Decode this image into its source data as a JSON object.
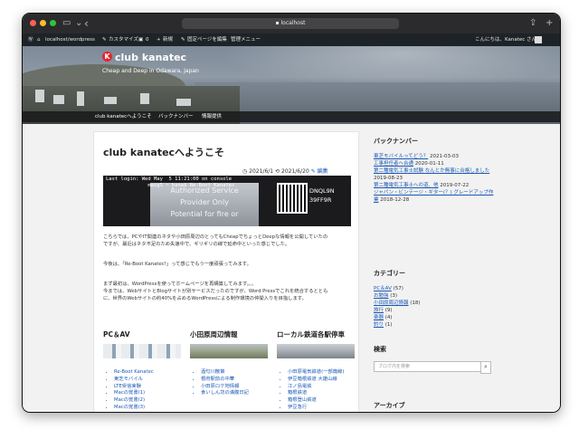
{
  "browser": {
    "address": "localhost",
    "lights": [
      "#ff5f57",
      "#febc2e",
      "#28c840"
    ]
  },
  "admin_bar": {
    "site": "localhost/wordpress",
    "customize": "カスタマイズ",
    "comments": "0",
    "new": "新規",
    "edit_page": "固定ページを編集",
    "menu_label": "管理メニュー",
    "greeting": "こんにちは、Kanatec さん"
  },
  "header": {
    "brand": "club kanatec",
    "logo_letter": "K",
    "tagline": "Cheap and Deep in Odawara, Japan"
  },
  "nav": [
    "club kanatecへようこそ",
    "バックナンバー",
    "情報提供"
  ],
  "post": {
    "title": "club kanatecへようこそ",
    "date": "2021/6/1",
    "modified": "2021/6/20",
    "edit": "編集",
    "hero_terminal": "Last login: Wed May  5 11:21:00 on console\n              macg5 ~ kana$ Re-Boot Kanatec",
    "hero_label_1": "Authorized Service",
    "hero_label_2": "Provider Only",
    "hero_label_3": "Potential for fire or",
    "hero_code_1": "DNQL9N",
    "hero_code_2": "39FF9R",
    "para1_line1": "こちらでは、PCやIT関連のネタや小田原周辺のとってもCheapでちょっとDeepな情報を公開していたの",
    "para1_line2": "ですが、最近はネタ不足のため失速中で、ギリギリの線で延命中といった感じでした。",
    "para2": "今後は、「Re-Boot Kanatec!」って感じでもう一度頑張ってみます。",
    "para3_line1": "まず最初は、WordPressを使ってホームページを再構築してみます。。。",
    "para3_line2": "今までは、WebサイトとBlogサイトが別サービスだったのですが、Word Pressでこれを統合するととも",
    "para3_line3": "に、世界のWebサイトの約40%を占めるWordPressによる制作環境の仲間入りを目指します。"
  },
  "columns": [
    {
      "title": "PC＆AV",
      "links": [
        "Re-Boot Kanatec",
        "東芝モバイル",
        "LTE受信実験",
        "Macの覚書(1)",
        "Macの覚書(2)",
        "Macの覚書(3)"
      ]
    },
    {
      "title": "小田原周辺情報",
      "links": [
        "酒匂川散策",
        "根府駅前の中華",
        "小田原ロケ地情報",
        "食いしん坊の満腹日記"
      ]
    },
    {
      "title": "ローカル鉄道各駅停車",
      "links": [
        "小田原電気鉄道(一部廃線)",
        "伊豆箱根鉄道 大雄山線",
        "江ノ島電鉄",
        "箱根鉄道",
        "箱根登山鉄道",
        "伊豆急行"
      ]
    }
  ],
  "sidebar": {
    "backnumber_title": "バックナンバー",
    "backnumber": [
      {
        "link": "東芝モバイルってどう？",
        "date": "2021-03-03"
      },
      {
        "link": "工事担任者へ合通",
        "date": "2020-01-11"
      },
      {
        "link": "第二種電気工事士試験 なんとか無事に合格しました",
        "date": "2019-08-23"
      },
      {
        "link": "第二種電気工事士への道、他",
        "date": "2019-07-22"
      },
      {
        "link": "ジャパン・ビンテージ・ギター(？) グレードアップ作業",
        "date": "2018-12-28"
      }
    ],
    "category_title": "カテゴリー",
    "categories": [
      {
        "name": "PC＆AV",
        "count": "(57)"
      },
      {
        "name": "お勉強",
        "count": "(3)"
      },
      {
        "name": "小田原周辺情報",
        "count": "(18)"
      },
      {
        "name": "旅行",
        "count": "(9)"
      },
      {
        "name": "楽器",
        "count": "(4)"
      },
      {
        "name": "釣り",
        "count": "(1)"
      }
    ],
    "search_title": "検索",
    "search_placeholder": "ブログ内を検索",
    "archive_title": "アーカイブ"
  }
}
